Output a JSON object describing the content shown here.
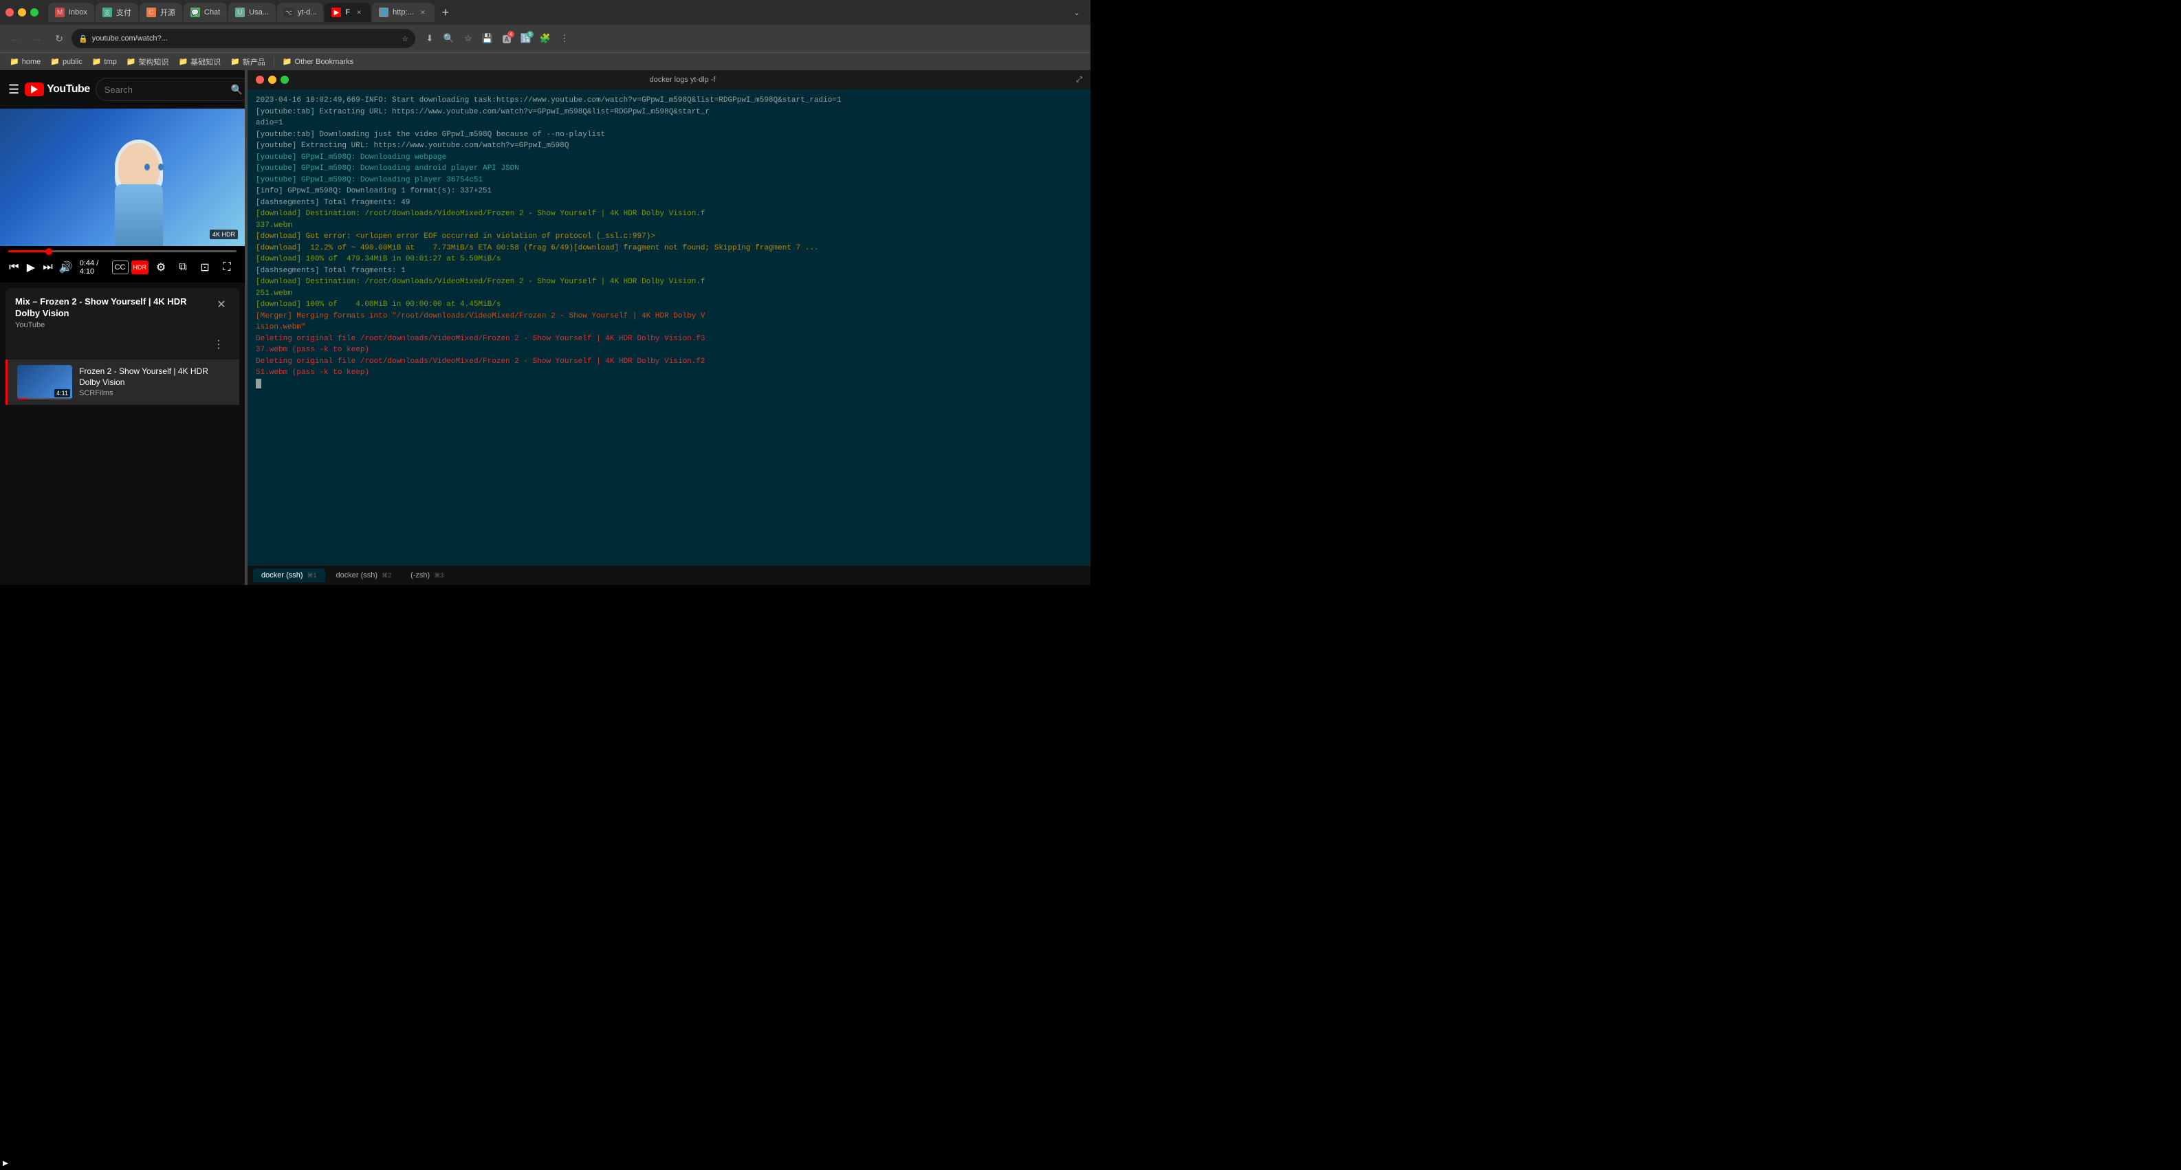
{
  "browser": {
    "tabs": [
      {
        "id": "gmail",
        "label": "Inbox",
        "favicon_color": "#c44",
        "favicon_char": "M",
        "active": false
      },
      {
        "id": "zhifu",
        "label": "支付",
        "favicon_color": "#4a8",
        "favicon_char": "💰",
        "active": false
      },
      {
        "id": "kaifang",
        "label": "开源",
        "favicon_color": "#e74",
        "favicon_char": "C",
        "active": false
      },
      {
        "id": "chat",
        "label": "Chat",
        "favicon_color": "#5a6",
        "favicon_char": "💬",
        "active": false
      },
      {
        "id": "usages",
        "label": "Usa...",
        "favicon_color": "#6a9",
        "favicon_char": "U",
        "active": false
      },
      {
        "id": "github",
        "label": "yt-d...",
        "favicon_color": "#333",
        "favicon_char": "⌥",
        "active": false
      },
      {
        "id": "youtube",
        "label": "F",
        "favicon_color": "#ff0000",
        "favicon_char": "▶",
        "active": true
      },
      {
        "id": "new",
        "label": "http:...",
        "favicon_color": "#888",
        "favicon_char": "🌐",
        "active": false
      }
    ],
    "url": "youtube.com/watch?...",
    "bookmarks": [
      "home",
      "public",
      "tmp",
      "架构知识",
      "基础知识",
      "新产品",
      "Other Bookmarks"
    ]
  },
  "youtube": {
    "logo_text": "YouTube",
    "search_placeholder": "Search",
    "video_time_current": "0:44",
    "video_time_total": "4:10",
    "progress_percent": 17.7,
    "mix_title": "Mix – Frozen 2 - Show Yourself | 4K HDR Dolby Vision",
    "mix_source": "YouTube",
    "playlist_item": {
      "title": "Frozen 2 - Show Yourself | 4K HDR Dolby Vision",
      "channel": "SCRFilms",
      "duration": "4:11"
    },
    "controls": {
      "skip_back": "⏮",
      "play": "▶",
      "skip_forward": "⏭",
      "volume": "🔊",
      "cc": "CC",
      "hdr_label": "HDR",
      "settings": "⚙",
      "miniplayer": "⧉",
      "theater": "⊡",
      "fullscreen": "⛶"
    }
  },
  "terminal": {
    "title": "docker logs yt-dlp -f",
    "lines": [
      "2023-04-16 10:02:49,669-INFO: Start downloading task:https://www.youtube.com/watch?v=GPpwI_m598Q&list=RDGPpwI_m598Q&start_radio=1",
      "[youtube:tab] Extracting URL: https://www.youtube.com/watch?v=GPpwI_m598Q&list=RDGPpwI_m598Q&start_r\nadio=1",
      "[youtube:tab] Downloading just the video GPpwI_m598Q because of --no-playlist",
      "[youtube] Extracting URL: https://www.youtube.com/watch?v=GPpwI_m598Q",
      "[youtube] GPpwI_m598Q: Downloading webpage",
      "[youtube] GPpwI_m598Q: Downloading android player API JSON",
      "[youtube] GPpwI_m598Q: Downloading player 36754c51",
      "[info] GPpwI_m598Q: Downloading 1 format(s): 337+251",
      "[dashsegments] Total fragments: 49",
      "[download] Destination: /root/downloads/VideoMixed/Frozen 2 - Show Yourself | 4K HDR Dolby Vision.f337.webm",
      "[download] Got error: <urlopen error EOF occurred in violation of protocol (_ssl.c:997)>",
      "[download]  12.2% of ~ 490.00MiB at    7.73MiB/s ETA 00:58 (frag 6/49)[download] fragment not found; Skipping fragment 7 ...",
      "[download] 100% of  479.34MiB in 00:01:27 at 5.50MiB/s",
      "[dashsegments] Total fragments: 1",
      "[download] Destination: /root/downloads/VideoMixed/Frozen 2 - Show Yourself | 4K HDR Dolby Vision.f251.webm",
      "[download] 100% of    4.08MiB in 00:00:00 at 4.45MiB/s",
      "[Merger] Merging formats into \"/root/downloads/VideoMixed/Frozen 2 - Show Yourself | 4K HDR Dolby Vision.webm\"",
      "Deleting original file /root/downloads/VideoMixed/Frozen 2 - Show Yourself | 4K HDR Dolby Vision.f337.webm (pass -k to keep)",
      "Deleting original file /root/downloads/VideoMixed/Frozen 2 - Show Yourself | 4K HDR Dolby Vision.f251.webm (pass -k to keep)"
    ],
    "tabs": [
      {
        "label": "docker (ssh)",
        "num": "⌘1",
        "active": true
      },
      {
        "label": "docker (ssh)",
        "num": "⌘2",
        "active": false
      },
      {
        "label": "(-zsh)",
        "num": "⌘3",
        "active": false
      }
    ]
  }
}
